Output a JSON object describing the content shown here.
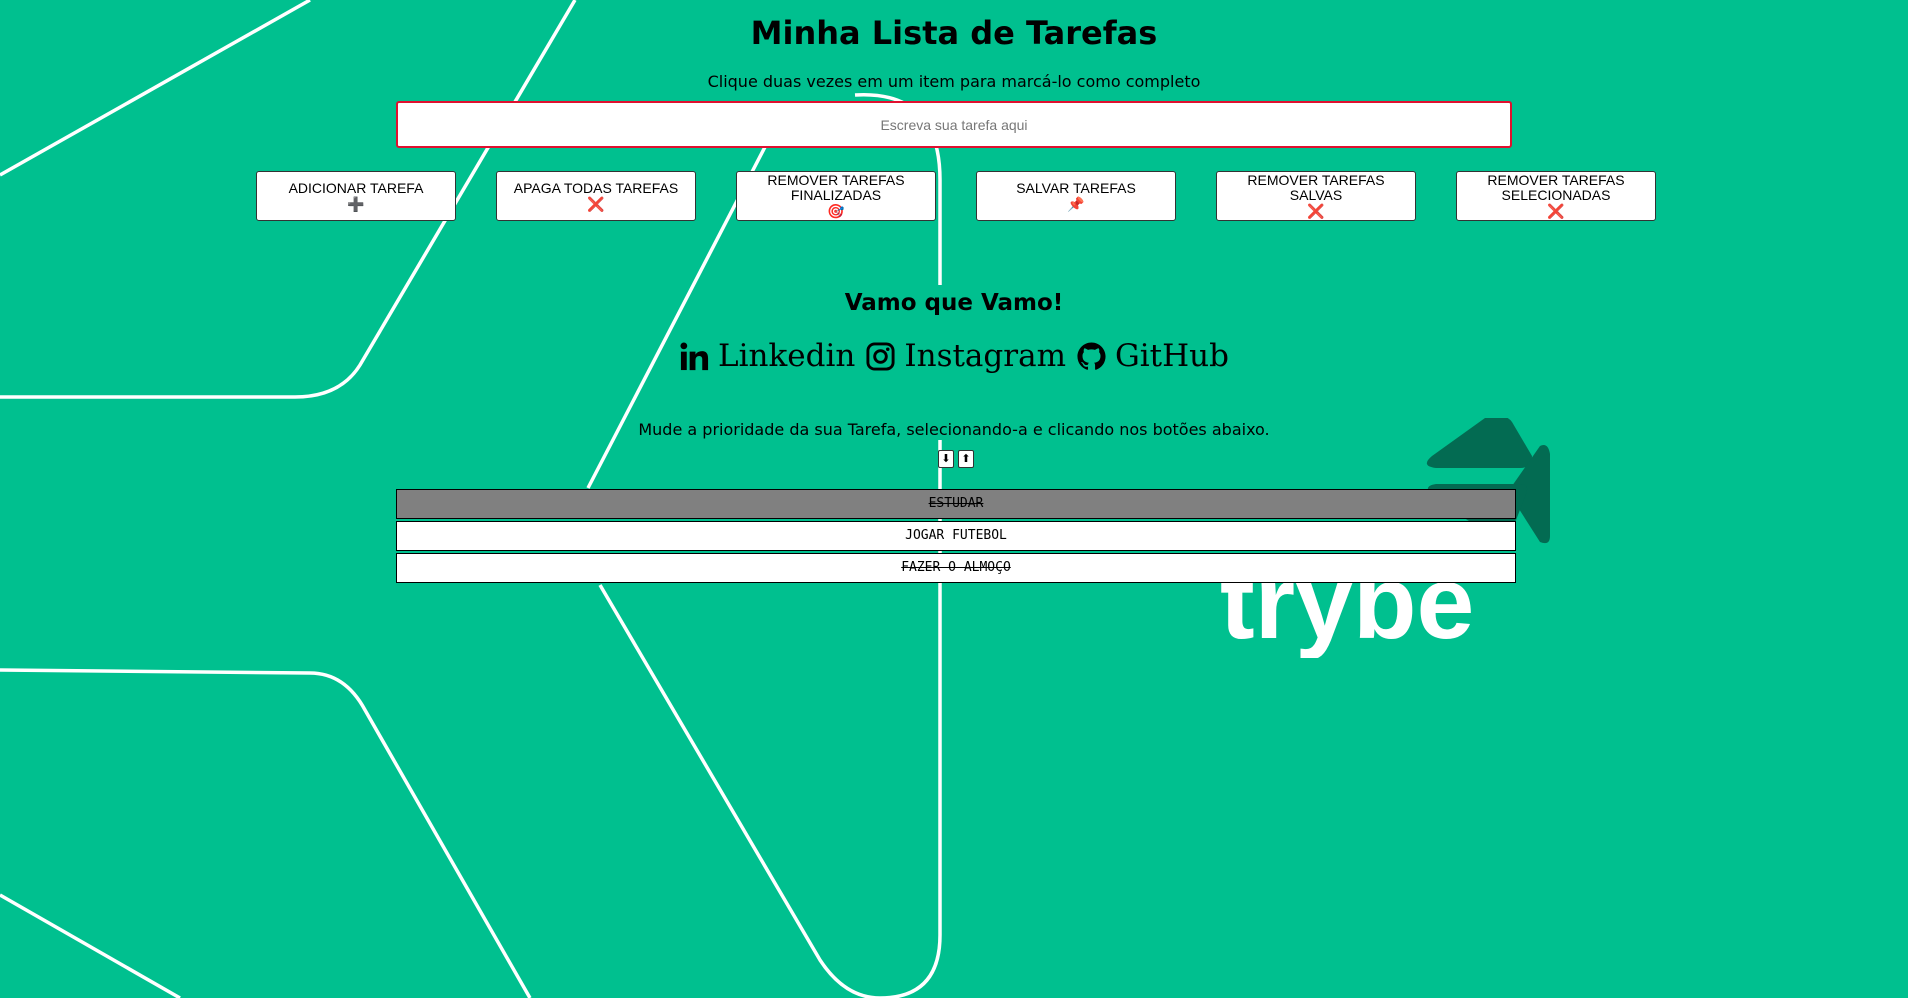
{
  "header": {
    "title": "Minha Lista de Tarefas",
    "subtitle": "Clique duas vezes em um item para marcá-lo como completo"
  },
  "input": {
    "placeholder": "Escreva sua tarefa aqui",
    "value": ""
  },
  "buttons": [
    {
      "label": "ADICIONAR TAREFA",
      "icon": "plus-icon",
      "glyph": "➕"
    },
    {
      "label": "APAGA TODAS TAREFAS",
      "icon": "cross-icon",
      "glyph": "❌"
    },
    {
      "label": "REMOVER TAREFAS FINALIZADAS",
      "icon": "target-icon",
      "glyph": "🎯"
    },
    {
      "label": "SALVAR TAREFAS",
      "icon": "pushpin-icon",
      "glyph": "📌"
    },
    {
      "label": "REMOVER TAREFAS SALVAS",
      "icon": "cross-icon",
      "glyph": "❌"
    },
    {
      "label": "REMOVER TAREFAS SELECIONADAS",
      "icon": "cross-icon",
      "glyph": "❌"
    }
  ],
  "section": {
    "heading": "Vamo que Vamo!"
  },
  "social": [
    {
      "label": "Linkedin",
      "icon": "linkedin-icon"
    },
    {
      "label": "Instagram",
      "icon": "instagram-icon"
    },
    {
      "label": "GitHub",
      "icon": "github-icon"
    }
  ],
  "priority": {
    "text": "Mude a prioridade da sua Tarefa, selecionando-a e clicando nos botões abaixo.",
    "down": "⬇",
    "up": "⬆"
  },
  "tasks": [
    {
      "text": "ESTUDAR",
      "completed": true,
      "selected": true
    },
    {
      "text": "JOGAR FUTEBOL",
      "completed": false,
      "selected": false
    },
    {
      "text": "FAZER O ALMOÇO",
      "completed": true,
      "selected": false
    }
  ],
  "brand": {
    "logo_text": "trybe"
  },
  "colors": {
    "background": "#00c08f",
    "input_border": "#e0102f",
    "selected_task": "#808080",
    "logo_dark": "#036b52"
  }
}
